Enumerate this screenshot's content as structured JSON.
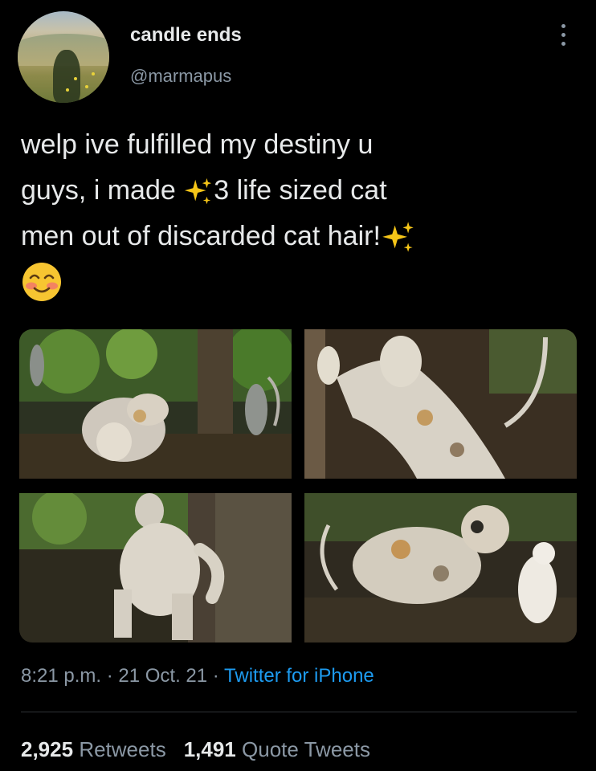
{
  "user": {
    "display_name": "candle ends",
    "handle": "@marmapus",
    "avatar_icon": "avatar-photo-shadow-field"
  },
  "menu_icon": "more-options-icon",
  "tweet": {
    "line1": "welp ive fulfilled my destiny u",
    "line2a": "guys, i made ",
    "line2b": "3 life sized cat",
    "line3": "men out of discarded cat hair!",
    "sparkle_icon": "sparkles-emoji",
    "blush_icon": "smiling-face-with-smiling-eyes-emoji"
  },
  "photos": [
    {
      "name": "photo-forest-cat-sculptures"
    },
    {
      "name": "photo-cat-man-hugging-tree"
    },
    {
      "name": "photo-cat-man-standing"
    },
    {
      "name": "photo-cat-man-with-kitten"
    }
  ],
  "meta": {
    "time": "8:21 p.m.",
    "sep1": " · ",
    "date": "21 Oct. 21",
    "sep2": " · ",
    "source": "Twitter for iPhone"
  },
  "stats": {
    "retweets_count": "2,925",
    "retweets_label": "Retweets",
    "quotes_count": "1,491",
    "quotes_label": "Quote Tweets"
  },
  "colors": {
    "background": "#000000",
    "text": "#e7e9ea",
    "secondary": "#8b98a5",
    "link": "#1d9bf0"
  }
}
